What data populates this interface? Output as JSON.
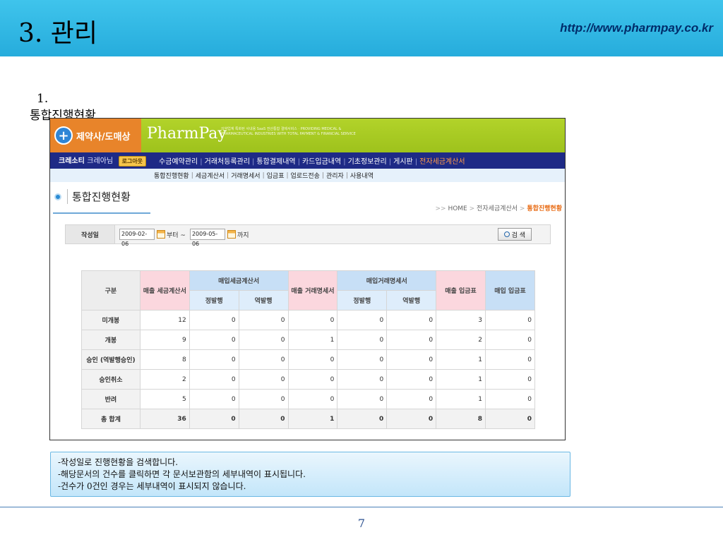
{
  "slide": {
    "title": "3. 관리",
    "url": "http://www.pharmpay.co.kr",
    "section_number": "1.",
    "section_label": "통합진행현황",
    "page_number": "7"
  },
  "app": {
    "brand_left": "제약사/도매상",
    "brand_name": "PharmPay",
    "brand_tagline": "의약업계 특화된 사내용 SaaS 전산통합 결제서비스 · PROVIDING MEDICAL & PHARMACEUTICAL INDUSTRIES WITH TOTAL PAYMENT & FINANCIAL SERVICE",
    "user_name": "크레소티",
    "user_suffix": "크레아님",
    "logout_label": "로그아웃",
    "menu": [
      "수금예약관리",
      "거래처등록관리",
      "통합결제내역",
      "카드입금내역",
      "기초정보관리",
      "게시판",
      "전자세금계산서"
    ],
    "sub_menu": [
      "통합진행현황",
      "세금계산서",
      "거래명세서",
      "입금표",
      "업로드전송",
      "관리자",
      "사용내역"
    ],
    "page_title": "통합진행현황",
    "breadcrumb": {
      "prefix": ">>",
      "home": "HOME",
      "parent": "전자세금계산서",
      "current": "통합진행현황"
    },
    "search": {
      "label": "작성일",
      "from_date": "2009-02-06",
      "from_suffix": "부터 ~",
      "to_date": "2009-05-06",
      "to_suffix": "까지",
      "button_label": "검 색"
    },
    "table": {
      "header": {
        "col_label": "구분",
        "sales_tax_invoice": "매출 세금계산서",
        "purchase_tax_invoice": "매입세금계산서",
        "sales_statement": "매출 거래명세서",
        "purchase_statement": "매입거래명세서",
        "sales_receipt": "매출 입금표",
        "purchase_receipt": "매입 입금표",
        "forward": "정발행",
        "reverse": "역발행"
      },
      "rows": [
        {
          "label": "미개봉",
          "values": [
            "12",
            "0",
            "0",
            "0",
            "0",
            "0",
            "3",
            "0"
          ]
        },
        {
          "label": "개봉",
          "values": [
            "9",
            "0",
            "0",
            "1",
            "0",
            "0",
            "2",
            "0"
          ]
        },
        {
          "label": "승인 (역발행승인)",
          "values": [
            "8",
            "0",
            "0",
            "0",
            "0",
            "0",
            "1",
            "0"
          ]
        },
        {
          "label": "승인취소",
          "values": [
            "2",
            "0",
            "0",
            "0",
            "0",
            "0",
            "1",
            "0"
          ]
        },
        {
          "label": "반려",
          "values": [
            "5",
            "0",
            "0",
            "0",
            "0",
            "0",
            "1",
            "0"
          ]
        },
        {
          "label": "총 합계",
          "values": [
            "36",
            "0",
            "0",
            "1",
            "0",
            "0",
            "8",
            "0"
          ]
        }
      ]
    }
  },
  "notes": [
    "-작성일로 진행현황을 검색합니다.",
    "-해당문서의 건수를 클릭하면 각 문서보관함의 세부내역이 표시됩니다.",
    "-건수가 0건인 경우는 세부내역이 표시되지 않습니다."
  ],
  "colors": {
    "header_blue": "#26acdc",
    "brand_green": "#9ec21c",
    "nav_navy": "#1e2a86",
    "brand_orange": "#e8842a",
    "active_orange": "#e86a12"
  }
}
